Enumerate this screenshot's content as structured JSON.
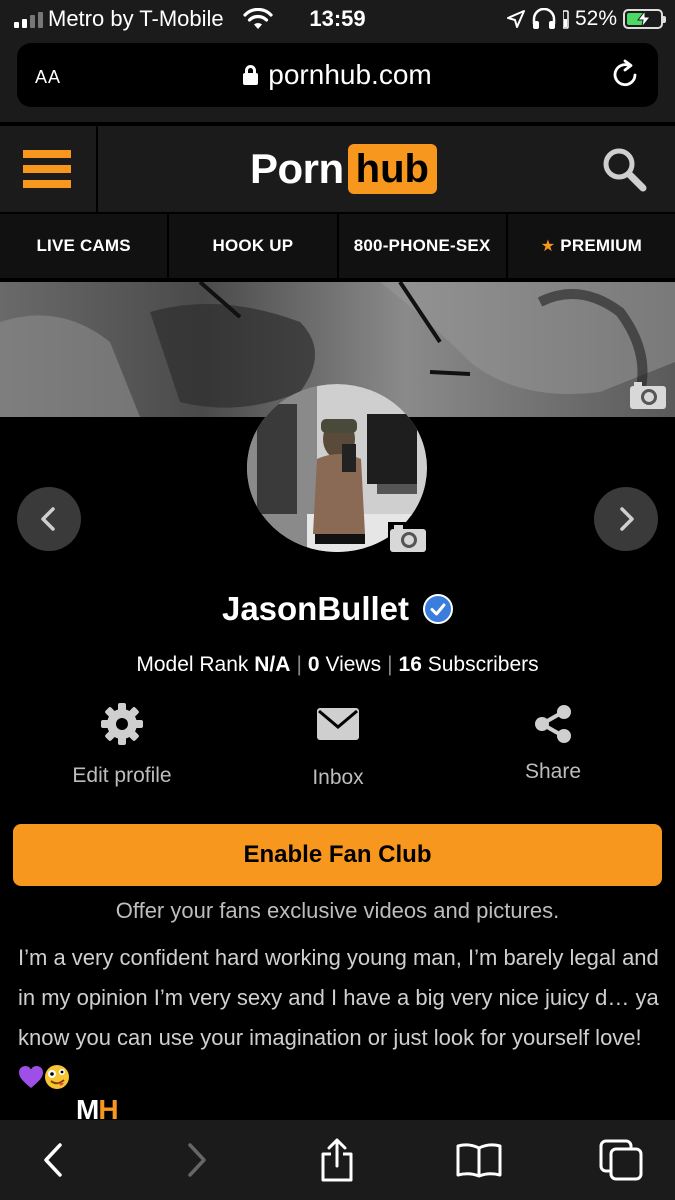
{
  "status_bar": {
    "carrier": "Metro by T-Mobile",
    "time": "13:59",
    "battery_pct": "52%",
    "battery_level": 0.52
  },
  "browser": {
    "text_size_label": "AA",
    "url": "pornhub.com"
  },
  "header": {
    "logo_left": "Porn",
    "logo_right": "hub"
  },
  "nav": [
    {
      "label": "LIVE CAMS"
    },
    {
      "label": "HOOK UP"
    },
    {
      "label": "800-PHONE-SEX"
    },
    {
      "label": "PREMIUM"
    }
  ],
  "profile": {
    "username": "JasonBullet",
    "model_rank_label": "Model Rank",
    "model_rank_value": "N/A",
    "views_value": "0",
    "views_label": "Views",
    "subscribers_value": "16",
    "subscribers_label": "Subscribers"
  },
  "actions": {
    "edit_profile": "Edit profile",
    "inbox": "Inbox",
    "share": "Share"
  },
  "fan_club": {
    "button_label": "Enable Fan Club",
    "subtitle": "Offer your fans exclusive videos and pictures."
  },
  "bio": {
    "text": "I’m a very confident hard working young man, I’m barely legal and in my opinion I’m very sexy and I have a big very nice juicy d… ya know you can use your imagination or just look for yourself love!"
  },
  "footer_logo": {
    "m": "M",
    "h": "H"
  },
  "colors": {
    "accent": "#f7971d",
    "background": "#000000",
    "bar": "#1b1b1b",
    "verified": "#3b7ddd"
  },
  "icons": [
    "signal-icon",
    "wifi-icon",
    "location-icon",
    "headphones-icon",
    "battery-icon",
    "lock-icon",
    "reload-icon",
    "hamburger-icon",
    "search-icon",
    "star-icon",
    "camera-icon",
    "chevron-left-icon",
    "chevron-right-icon",
    "verified-icon",
    "gear-icon",
    "mail-icon",
    "share-icon",
    "back-icon",
    "forward-icon",
    "share-sheet-icon",
    "bookmarks-icon",
    "tabs-icon"
  ]
}
